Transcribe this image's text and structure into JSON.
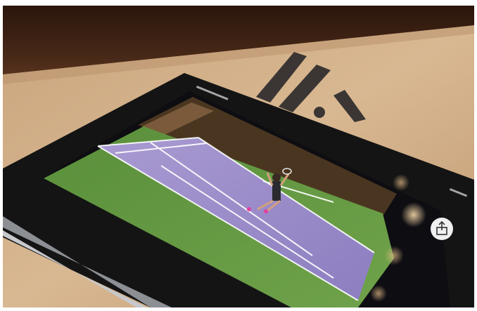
{
  "photo": {
    "status_bar_text": "",
    "status_icons_text": "",
    "share_icon_name": "share-icon",
    "logo_icon_name": "brand-logo-icon"
  }
}
